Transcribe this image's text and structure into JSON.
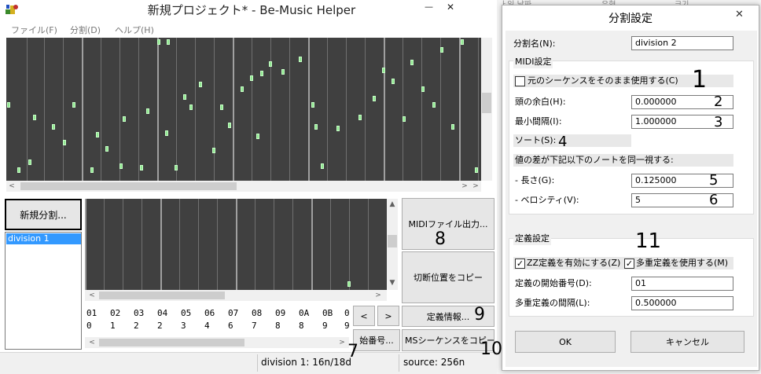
{
  "main_window": {
    "title": "新規プロジェクト* - Be-Music Helper",
    "menu": [
      "ファイル(F)",
      "分割(D)",
      "ヘルプ(H)"
    ],
    "minimize": "—",
    "close": "✕"
  },
  "left_panel": {
    "new_split_button": "新規分割...",
    "divisions": [
      "division 1"
    ]
  },
  "action_buttons": {
    "midi_export": "MIDIファイル出力...",
    "copy_cut_positions": "切断位置をコピー",
    "definition_info": "定義情報...",
    "ms_sequence_copy": "MSシーケンスをコピー",
    "start_number": "始番号...",
    "prev": "<",
    "next": ">"
  },
  "definition_table": {
    "row1": [
      "01",
      "02",
      "03",
      "04",
      "05",
      "06",
      "07",
      "08",
      "09",
      "0A",
      "0B",
      "0"
    ],
    "row2": [
      "0",
      "1",
      "2",
      "2",
      "3",
      "4",
      "6",
      "7",
      "8",
      "8",
      "9",
      "9"
    ]
  },
  "status_bar": {
    "division_info": "division 1: 16n/18d",
    "source_info": "source: 256n"
  },
  "bg_table_headers": [
    "ㅏ일 날짜",
    "유형",
    "크기"
  ],
  "dialog": {
    "title": "分割設定",
    "close": "✕",
    "name_label": "分割名(N):",
    "name_value": "division 2",
    "midi_group": "MIDI設定",
    "use_original": "元のシーケンスをそのまま使用する(C)",
    "head_margin_label": "頭の余白(H):",
    "head_margin_value": "0.000000",
    "min_interval_label": "最小間隔(I):",
    "min_interval_value": "1.000000",
    "sort_label": "ソート(S):",
    "same_note_label": "値の差が下記以下のノートを同一視する:",
    "length_label": "- 長さ(G):",
    "length_value": "0.125000",
    "velocity_label": "- ベロシティ(V):",
    "velocity_value": "5",
    "def_group": "定義設定",
    "zz_def": "ZZ定義を有効にする(Z)",
    "multi_def": "多重定義を使用する(M)",
    "def_start_label": "定義の開始番号(D):",
    "def_start_value": "01",
    "multi_interval_label": "多重定義の間隔(L):",
    "multi_interval_value": "0.500000",
    "ok": "OK",
    "cancel": "キャンセル"
  },
  "annotations": [
    "1",
    "2",
    "3",
    "4",
    "5",
    "6",
    "7",
    "8",
    "9",
    "10",
    "11"
  ]
}
